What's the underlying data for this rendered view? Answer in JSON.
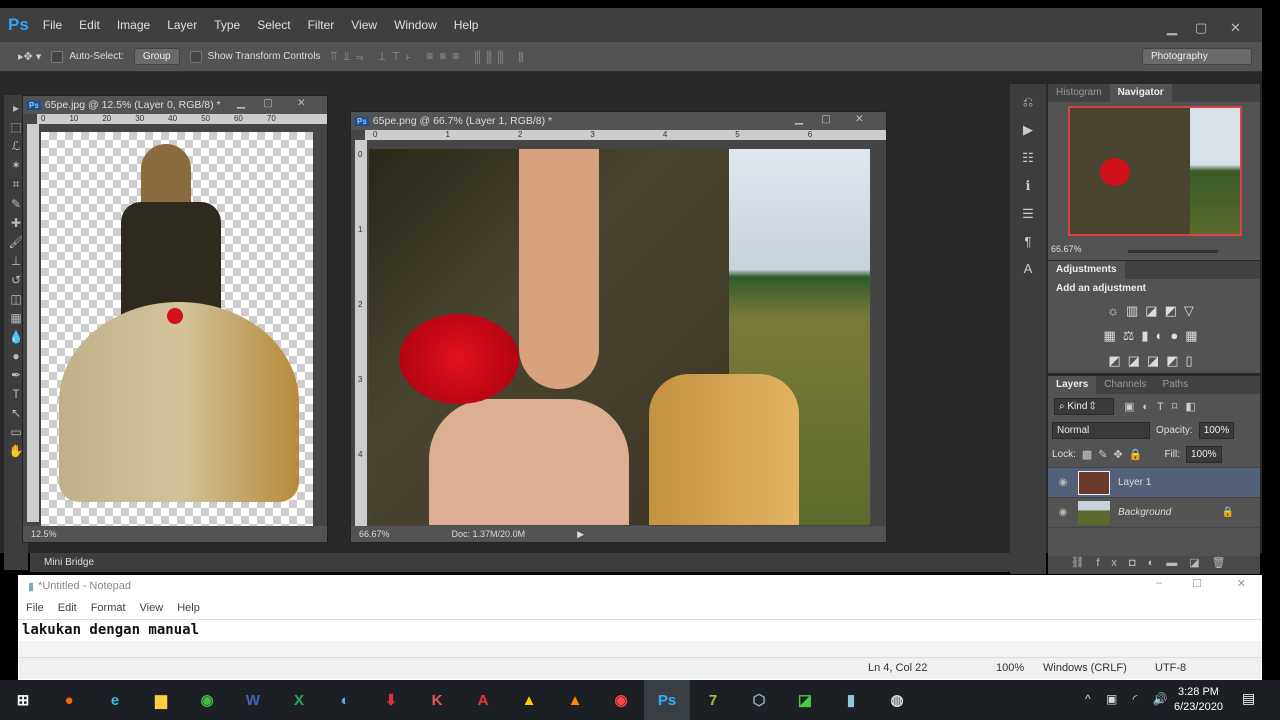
{
  "app": {
    "logo": "Ps",
    "menu": [
      "File",
      "Edit",
      "Image",
      "Layer",
      "Type",
      "Select",
      "Filter",
      "View",
      "Window",
      "Help"
    ],
    "workspace": "Photography"
  },
  "options": {
    "auto_select": "Auto-Select:",
    "group": "Group",
    "show_transform": "Show Transform Controls"
  },
  "doc1": {
    "title": "65pe.jpg @ 12.5% (Layer 0, RGB/8) *",
    "zoom": "12.5%",
    "ruler": [
      "0",
      "10",
      "20",
      "30",
      "40",
      "50",
      "60",
      "70"
    ]
  },
  "doc2": {
    "title": "65pe.png @ 66.7% (Layer 1, RGB/8) *",
    "zoom": "66.67%",
    "doc": "Doc: 1.37M/20.0M",
    "ruler": [
      "0",
      "1",
      "2",
      "3",
      "4",
      "5",
      "6"
    ],
    "vruler": [
      "0",
      "1",
      "2",
      "3",
      "4"
    ]
  },
  "navigator": {
    "tabs": [
      "Histogram",
      "Navigator"
    ],
    "zoom": "66.67%"
  },
  "adjustments": {
    "title": "Adjustments",
    "subtitle": "Add an adjustment"
  },
  "layers": {
    "tabs": [
      "Layers",
      "Channels",
      "Paths"
    ],
    "kind": "Kind",
    "blend": "Normal",
    "opacity_label": "Opacity:",
    "opacity": "100%",
    "lock_label": "Lock:",
    "fill_label": "Fill:",
    "fill": "100%",
    "items": [
      {
        "name": "Layer 1"
      },
      {
        "name": "Background"
      }
    ]
  },
  "mini_bridge": "Mini Bridge",
  "notepad": {
    "title": "*Untitled - Notepad",
    "menu": [
      "File",
      "Edit",
      "Format",
      "View",
      "Help"
    ],
    "text": "lakukan dengan manual",
    "pos": "Ln 4, Col 22",
    "zoom": "100%",
    "eol": "Windows (CRLF)",
    "enc": "UTF-8"
  },
  "taskbar": {
    "time": "3:28 PM",
    "date": "6/23/2020"
  }
}
